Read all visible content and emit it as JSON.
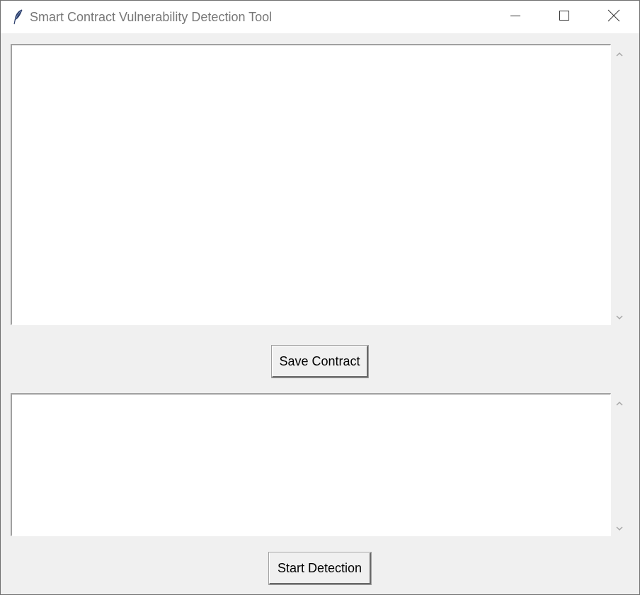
{
  "window": {
    "title": "Smart Contract Vulnerability Detection Tool",
    "controls": {
      "minimize_icon": "minimize-icon",
      "maximize_icon": "maximize-icon",
      "close_icon": "close-icon"
    },
    "app_icon": "feather-icon"
  },
  "contract_editor": {
    "value": "",
    "scrollbar_icons": [
      "chevron-up-icon",
      "chevron-down-icon"
    ]
  },
  "toolbar": {
    "save_label": "Save Contract",
    "detect_label": "Start Detection"
  },
  "results_box": {
    "value": "",
    "scrollbar_icons": [
      "chevron-up-icon",
      "chevron-down-icon"
    ]
  },
  "colors": {
    "window_bg": "#f0f0f0",
    "titlebar_bg": "#ffffff",
    "text_area_bg": "#ffffff",
    "title_text": "#777777"
  }
}
